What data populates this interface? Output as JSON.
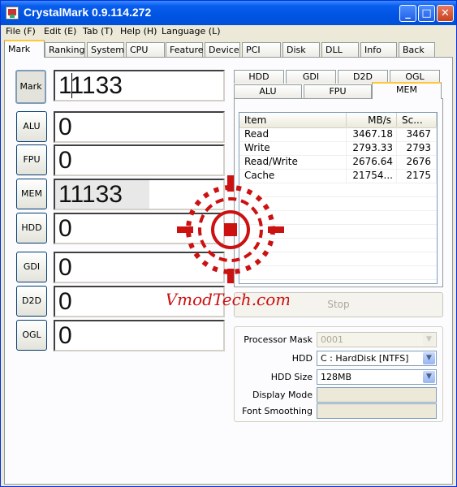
{
  "window": {
    "title": "CrystalMark 0.9.114.272",
    "buttons": {
      "minimize": "_",
      "maximize": "□",
      "close": "✕"
    }
  },
  "menu": [
    {
      "label": "File (F)"
    },
    {
      "label": "Edit (E)"
    },
    {
      "label": "Tab (T)"
    },
    {
      "label": "Help (H)"
    },
    {
      "label": "Language (L)"
    }
  ],
  "tabs": [
    {
      "label": "Mark",
      "active": true
    },
    {
      "label": "Ranking"
    },
    {
      "label": "System"
    },
    {
      "label": "CPU"
    },
    {
      "label": "Feature"
    },
    {
      "label": "Device"
    },
    {
      "label": "PCI"
    },
    {
      "label": "Disk"
    },
    {
      "label": "DLL"
    },
    {
      "label": "Info"
    },
    {
      "label": "Back"
    }
  ],
  "scores": [
    {
      "label": "Mark",
      "value": "11133",
      "pressed": true
    },
    {
      "label": "ALU",
      "value": "0"
    },
    {
      "label": "FPU",
      "value": "0"
    },
    {
      "label": "MEM",
      "value": "11133",
      "shaded": true
    },
    {
      "label": "HDD",
      "value": "0"
    },
    {
      "label": "GDI",
      "value": "0"
    },
    {
      "label": "D2D",
      "value": "0"
    },
    {
      "label": "OGL",
      "value": "0"
    }
  ],
  "result_tabs": {
    "row1": [
      "HDD",
      "GDI",
      "D2D",
      "OGL"
    ],
    "row2": [
      "ALU",
      "FPU",
      "MEM"
    ],
    "active": "MEM"
  },
  "results_table": {
    "columns": [
      "Item",
      "MB/s",
      "Sc..."
    ],
    "rows": [
      [
        "Read",
        "3467.18",
        "3467"
      ],
      [
        "Write",
        "2793.33",
        "2793"
      ],
      [
        "Read/Write",
        "2676.64",
        "2676"
      ],
      [
        "Cache",
        "21754...",
        "2175"
      ]
    ]
  },
  "stop_label": "Stop",
  "settings": {
    "processor_mask": {
      "label": "Processor Mask",
      "value": "0001"
    },
    "hdd": {
      "label": "HDD",
      "value": "C : HardDisk [NTFS]"
    },
    "hdd_size": {
      "label": "HDD Size",
      "value": "128MB"
    },
    "display_mode": {
      "label": "Display Mode",
      "value": ""
    },
    "font_smoothing": {
      "label": "Font Smoothing",
      "value": ""
    }
  },
  "watermark": {
    "text": "VmodTech.com",
    "color": "#CC1111"
  }
}
